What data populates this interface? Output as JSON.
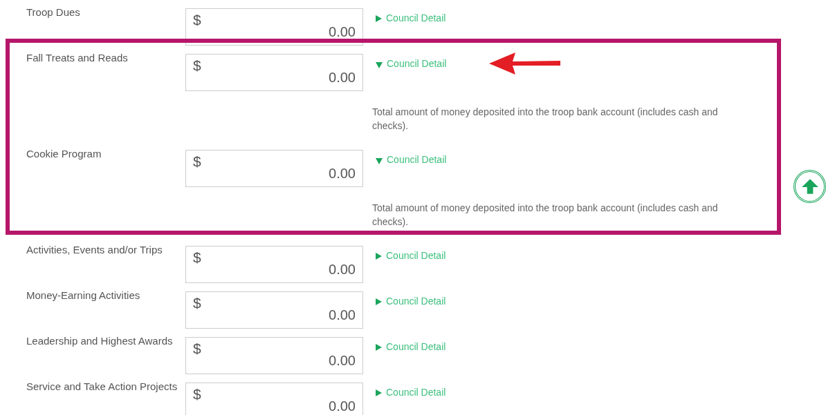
{
  "rows": [
    {
      "label": "Troop Dues",
      "currency": "$",
      "value": "0.00",
      "link": "Council Detail",
      "expanded": false
    },
    {
      "label": "Fall Treats and Reads",
      "currency": "$",
      "value": "0.00",
      "link": "Council Detail",
      "expanded": true,
      "detail": "Total amount of money deposited into the troop bank account (includes cash and checks)."
    },
    {
      "label": "Cookie Program",
      "currency": "$",
      "value": "0.00",
      "link": "Council Detail",
      "expanded": true,
      "detail": "Total amount of money deposited into the troop bank account (includes cash and checks)."
    },
    {
      "label": "Activities, Events and/or Trips",
      "currency": "$",
      "value": "0.00",
      "link": "Council Detail",
      "expanded": false
    },
    {
      "label": "Money-Earning Activities",
      "currency": "$",
      "value": "0.00",
      "link": "Council Detail",
      "expanded": false
    },
    {
      "label": "Leadership and Highest Awards",
      "currency": "$",
      "value": "0.00",
      "link": "Council Detail",
      "expanded": false
    },
    {
      "label": "Service and Take Action Projects",
      "currency": "$",
      "value": "0.00",
      "link": "Council Detail",
      "expanded": false
    }
  ]
}
